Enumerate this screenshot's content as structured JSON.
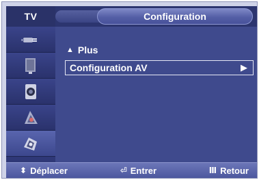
{
  "header": {
    "tv_label": "TV",
    "title": "Configuration"
  },
  "sidebar": {
    "items": [
      {
        "icon": "antenna-plug-icon"
      },
      {
        "icon": "tv-panel-icon"
      },
      {
        "icon": "speaker-icon"
      },
      {
        "icon": "picture-icon"
      },
      {
        "icon": "setup-icon"
      }
    ]
  },
  "menu": {
    "plus_label": "Plus",
    "plus_glyph": "▲",
    "selected_label": "Configuration AV",
    "selected_arrow": "▶"
  },
  "footer": {
    "move_glyph": "⬍",
    "move_label": "Déplacer",
    "enter_glyph": "⏎",
    "enter_label": "Entrer",
    "return_glyph": "Ⅲ",
    "return_label": "Retour"
  }
}
